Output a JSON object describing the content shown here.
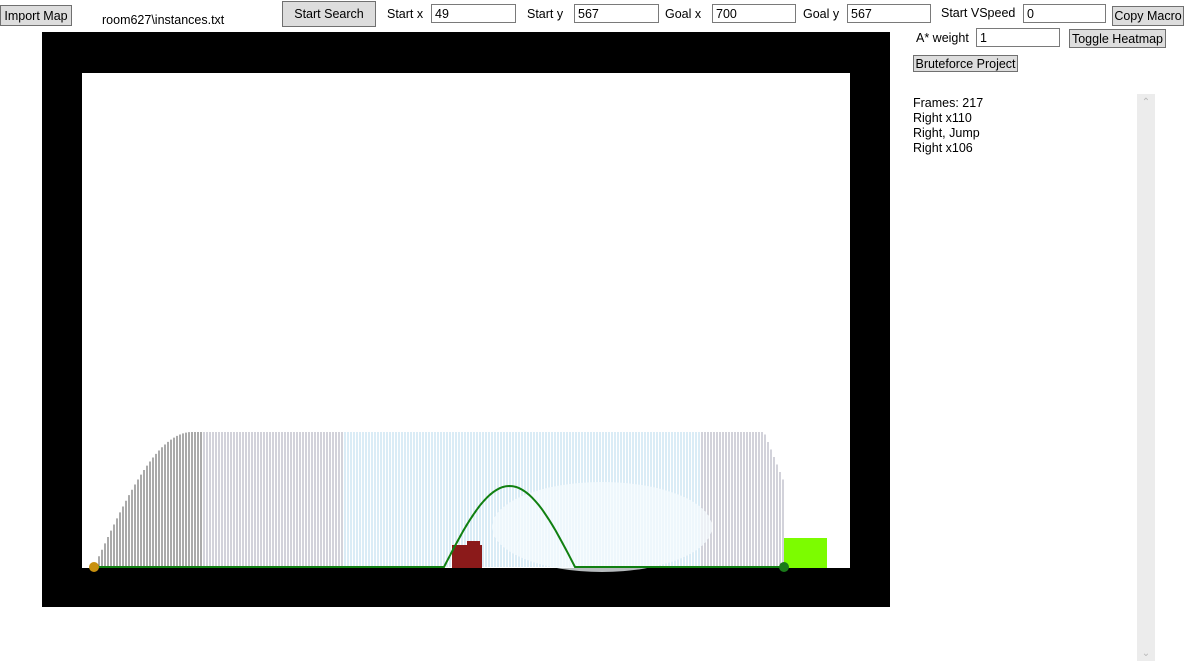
{
  "toolbar": {
    "import_label": "Import Map",
    "map_file": "room627\\instances.txt",
    "start_search_label": "Start Search",
    "start_x_label": "Start x",
    "start_x_value": "49",
    "start_y_label": "Start y",
    "start_y_value": "567",
    "goal_x_label": "Goal x",
    "goal_x_value": "700",
    "goal_y_label": "Goal y",
    "goal_y_value": "567",
    "vspeed_label": "Start VSpeed",
    "vspeed_value": "0",
    "copy_macro_label": "Copy Macro",
    "astar_label": "A* weight",
    "astar_value": "1",
    "heatmap_label": "Toggle Heatmap",
    "bruteforce_label": "Bruteforce Project"
  },
  "output": {
    "lines": [
      "Frames: 217",
      "Right x110",
      "Right, Jump",
      "Right x106"
    ]
  },
  "scrollbar": {
    "up_icon": "chevron-up-icon",
    "down_icon": "chevron-down-icon"
  },
  "colors": {
    "wall": "#000000",
    "path": "#118011",
    "start_marker": "#c8900e",
    "goal_marker": "#1a7a1a",
    "goal_zone": "#7cfc00",
    "obstacle": "#8b1a1a",
    "heat_dark": "#3a3a3a",
    "heat_blue": "#5aa8d8",
    "heat_light": "#e8f6fa"
  }
}
